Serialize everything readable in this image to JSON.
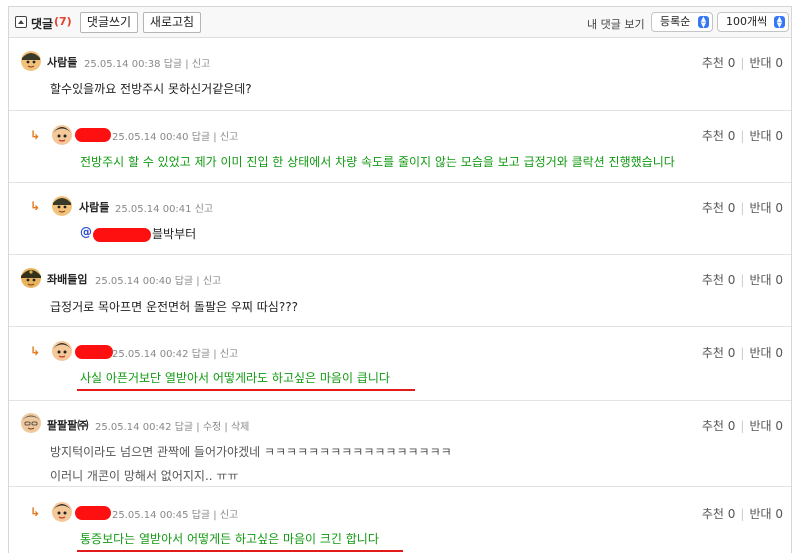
{
  "toolbar": {
    "title": "댓글",
    "count": "(7)",
    "write_label": "댓글쓰기",
    "refresh_label": "새로고침",
    "my_comments_label": "내 댓글 보기",
    "sort_value": "등록순",
    "page_size_value": "100개씩"
  },
  "votes": {
    "like_label": "추천",
    "dislike_label": "반대"
  },
  "comments": [
    {
      "nick": "사람들",
      "date": "25.05.14 00:38",
      "actions": "답글 | 신고",
      "text": "할수있을까요 전방주시 못하신거같은데?",
      "likes": "0",
      "dislikes": "0"
    },
    {
      "nick": "",
      "date": "25.05.14 00:40",
      "actions": "답글 | 신고",
      "text": "전방주시 할 수 있었고 제가 이미 진입 한 상태에서 차량 속도를 줄이지 않는 모습을 보고 급정거와 클락션 진행했습니다",
      "likes": "0",
      "dislikes": "0"
    },
    {
      "nick": "사람들",
      "date": "25.05.14 00:41",
      "actions": "신고",
      "mention": "@",
      "text": "블박부터",
      "likes": "0",
      "dislikes": "0"
    },
    {
      "nick": "좌배들임",
      "date": "25.05.14 00:40",
      "actions": "답글 | 신고",
      "text": "급정거로 목아프면 운전면허 돌팔은 우찌 따심???",
      "likes": "0",
      "dislikes": "0"
    },
    {
      "nick": "",
      "date": "25.05.14 00:42",
      "actions": "답글 | 신고",
      "text": "사실 아픈거보단 열받아서 어떻게라도 하고싶은 마음이 큽니다",
      "likes": "0",
      "dislikes": "0"
    },
    {
      "nick": "팔팔팔㈜",
      "date": "25.05.14 00:42",
      "actions": "답글 | 수정 | 삭제",
      "text": "방지턱이라도 넘으면 관짝에 들어가야겠네 ㅋㅋㅋㅋㅋㅋㅋㅋㅋㅋㅋㅋㅋㅋㅋㅋㅋ",
      "text2": "이러니 개콘이 망해서 없어지지.. ㅠㅠ",
      "likes": "0",
      "dislikes": "0"
    },
    {
      "nick": "",
      "date": "25.05.14 00:45",
      "actions": "답글 | 신고",
      "text": "통증보다는 열받아서 어떻게든 하고싶은 마음이 크긴 합니다",
      "likes": "0",
      "dislikes": "0"
    }
  ]
}
